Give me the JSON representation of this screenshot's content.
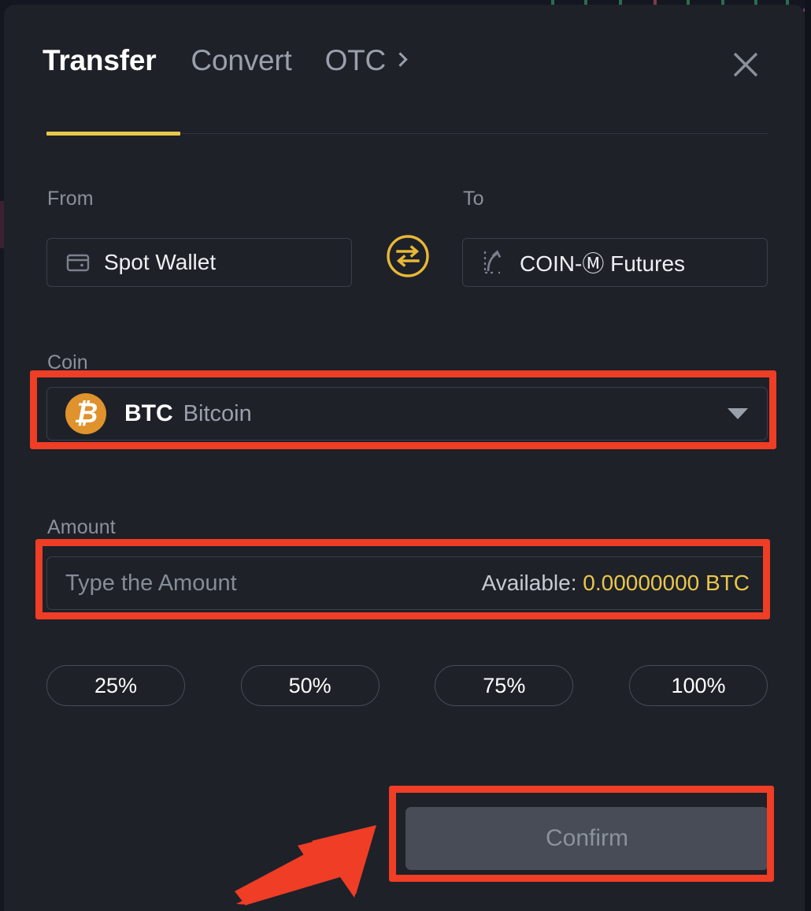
{
  "theme": {
    "panel_bg": "#1e2128",
    "page_bg": "#14171f",
    "accent_yellow": "#eac74a",
    "accent_orange": "#e0922d",
    "annotation_red": "#ef3d26",
    "text_primary": "#ffffff",
    "text_muted": "#9aa0ab",
    "border": "#3a3f49",
    "disabled_button_bg": "#474c56",
    "disabled_button_text": "#8c929c"
  },
  "header": {
    "tabs": [
      {
        "label": "Transfer",
        "state": "active"
      },
      {
        "label": "Convert",
        "state": "inactive"
      },
      {
        "label": "OTC",
        "state": "inactive",
        "icon": "chevron-right-icon"
      }
    ],
    "close_icon": "close-icon"
  },
  "transfer_form": {
    "from": {
      "label": "From",
      "value": "Spot Wallet",
      "icon": "wallet-icon"
    },
    "swap": {
      "icon": "swap-arrows-icon"
    },
    "to": {
      "label": "To",
      "value": "COIN-Ⓜ Futures",
      "icon": "trending-up-icon"
    },
    "coin": {
      "label": "Coin",
      "logo_icon": "bitcoin-icon",
      "logo_glyph": "₿",
      "symbol": "BTC",
      "name": "Bitcoin",
      "caret_icon": "caret-down-icon"
    },
    "amount": {
      "label": "Amount",
      "value": "",
      "placeholder": "Type the Amount",
      "available_label": "Available:",
      "available_value": "0.00000000 BTC"
    },
    "percent_buttons": [
      {
        "label": "25%"
      },
      {
        "label": "50%"
      },
      {
        "label": "75%"
      },
      {
        "label": "100%"
      }
    ],
    "confirm": {
      "label": "Confirm",
      "state": "disabled"
    }
  },
  "annotations": {
    "boxes": [
      {
        "target": "coin-selector"
      },
      {
        "target": "amount-input"
      },
      {
        "target": "confirm-button"
      }
    ],
    "arrow": {
      "points_to": "confirm-button",
      "direction": "up-right"
    }
  }
}
